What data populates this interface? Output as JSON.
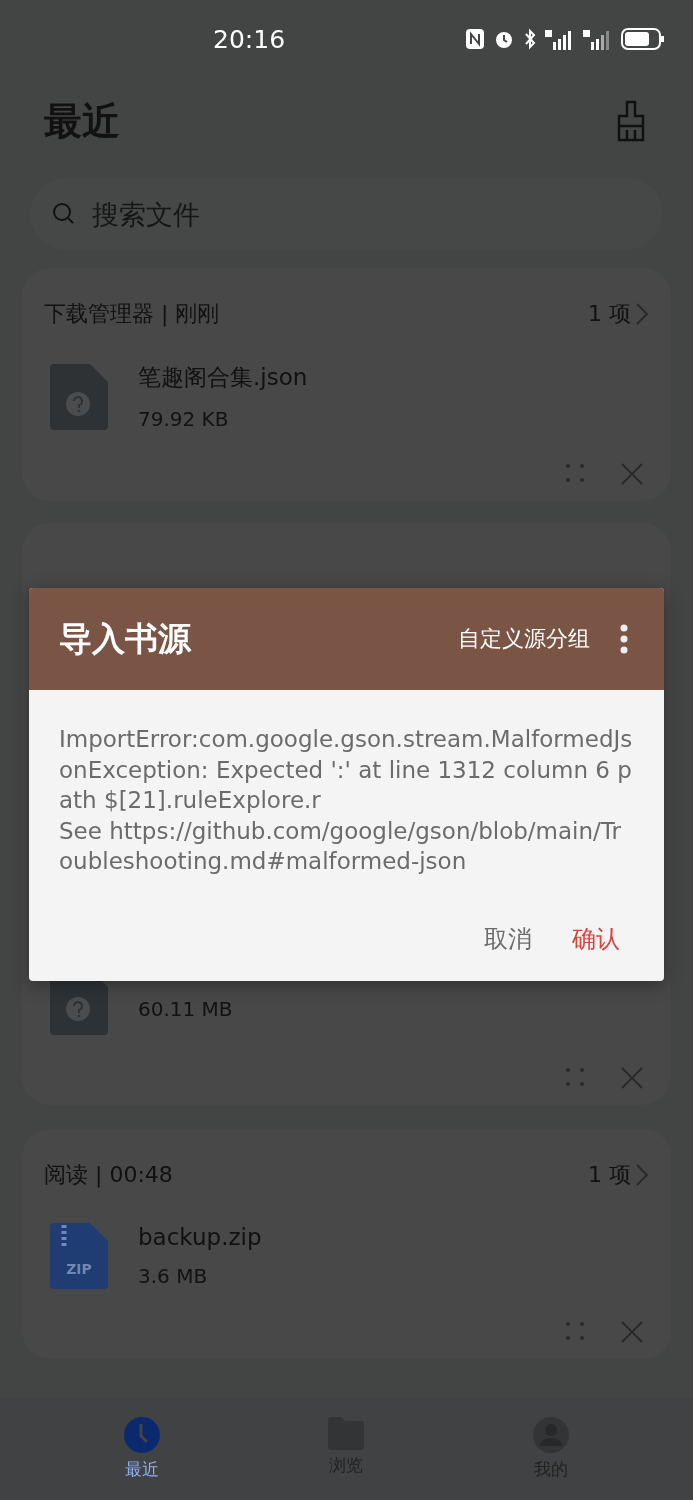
{
  "status_bar": {
    "time": "20:16"
  },
  "header": {
    "title": "最近"
  },
  "search": {
    "placeholder": "搜索文件"
  },
  "groups": [
    {
      "title": "下载管理器 | 刚刚",
      "count": "1 项",
      "file": {
        "kind": "unknown",
        "name": "笔趣阁合集.json",
        "size": "79.92 KB"
      }
    },
    {
      "file": {
        "kind": "unknown",
        "size": "60.11 MB"
      }
    },
    {
      "title": "阅读 | 00:48",
      "count": "1 项",
      "file": {
        "kind": "zip",
        "badge": "ZIP",
        "name": "backup.zip",
        "size": "3.6 MB"
      }
    }
  ],
  "dialog": {
    "title": "导入书源",
    "action": "自定义源分组",
    "message": "ImportError:com.google.gson.stream.MalformedJsonException: Expected ':' at line 1312 column 6 path $[21].ruleExplore.r\nSee https://github.com/google/gson/blob/main/Troubleshooting.md#malformed-json",
    "buttons": [
      {
        "label": "取消",
        "kind": "cancel"
      },
      {
        "label": "确认",
        "kind": "confirm"
      }
    ]
  },
  "bottom_nav": [
    {
      "label": "最近",
      "kind": "clock",
      "selected": true
    },
    {
      "label": "浏览",
      "kind": "folder",
      "selected": false
    },
    {
      "label": "我的",
      "kind": "person",
      "selected": false
    }
  ]
}
